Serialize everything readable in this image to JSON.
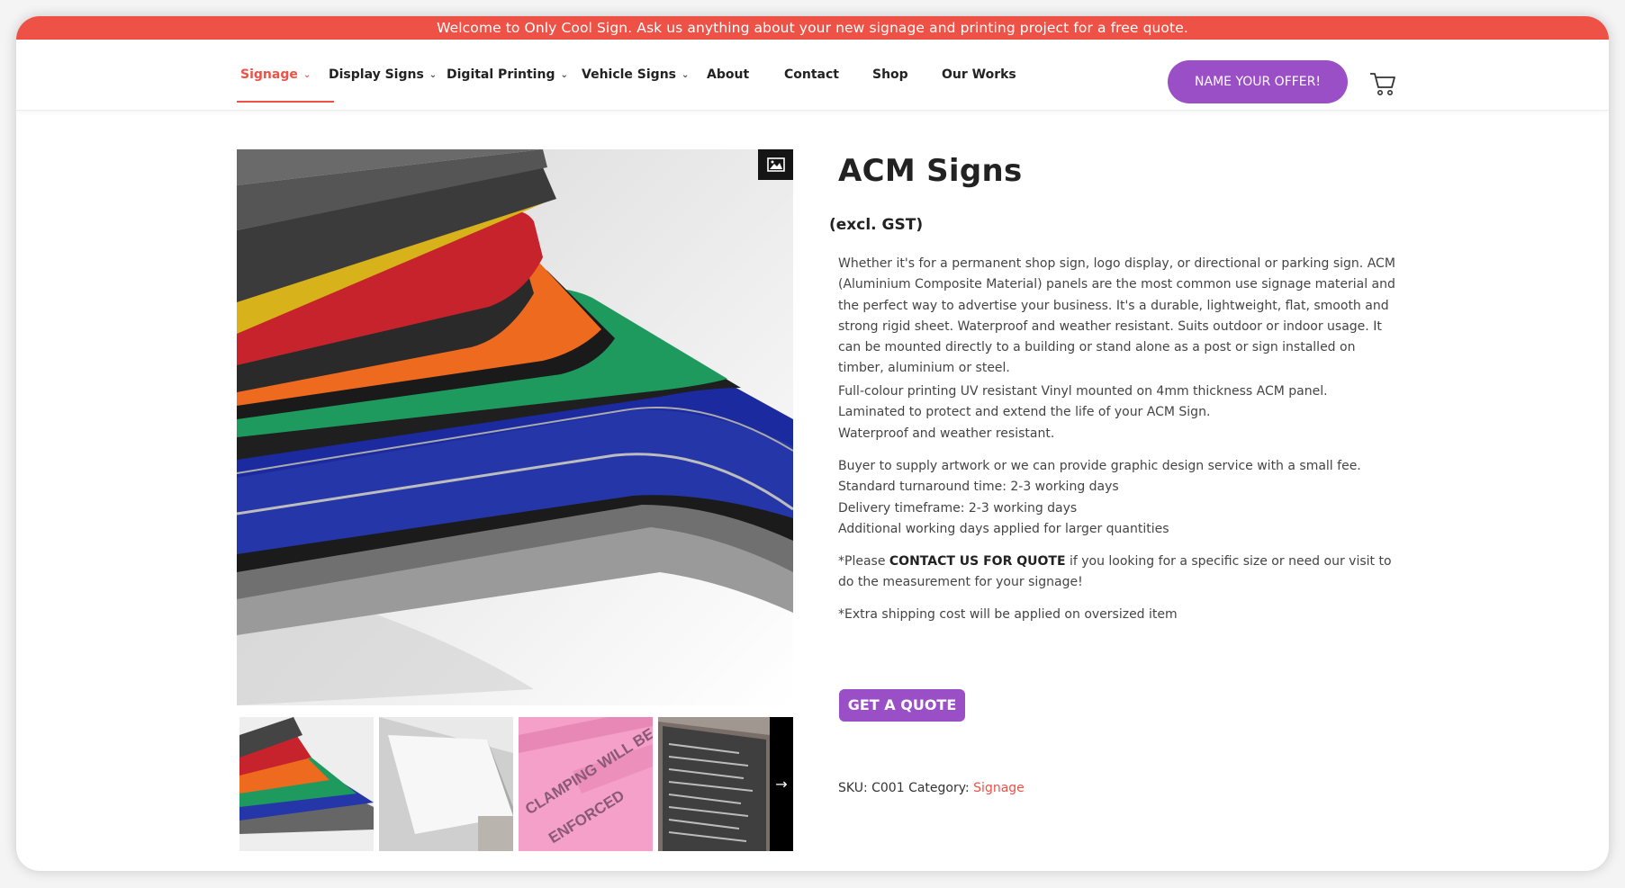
{
  "announcement": "Welcome to Only Cool Sign. Ask us anything about your new signage and printing project for a free quote.",
  "nav": {
    "items": [
      {
        "label": "Signage",
        "dropdown": true
      },
      {
        "label": "Display Signs",
        "dropdown": true
      },
      {
        "label": "Digital Printing",
        "dropdown": true
      },
      {
        "label": "Vehicle Signs",
        "dropdown": true
      },
      {
        "label": "About",
        "dropdown": false
      },
      {
        "label": "Contact",
        "dropdown": false
      },
      {
        "label": "Shop",
        "dropdown": false
      },
      {
        "label": "Our Works",
        "dropdown": false
      }
    ],
    "active": "Signage",
    "offer_button": "NAME YOUR OFFER!",
    "cart_icon": "cart-icon"
  },
  "product": {
    "title": "ACM Signs",
    "price_note": "(excl. GST)",
    "description": [
      "Whether it's for a permanent shop sign, logo display, or directional or parking sign. ACM (Aluminium Composite Material) panels are the most common use signage material and the perfect way to advertise your business. It's a durable, lightweight, flat, smooth and strong rigid sheet. Waterproof and weather resistant. Suits outdoor or indoor usage. It can be mounted directly to a building or stand alone as a post or sign installed on timber, aluminium or steel."
    ],
    "features": [
      "Full-colour printing UV resistant Vinyl mounted on 4mm thickness ACM panel.",
      "Laminated to protect and extend the life of your ACM Sign.",
      "Waterproof and weather resistant."
    ],
    "service": [
      "Buyer to supply artwork or we can provide graphic design service with a small fee.",
      "Standard turnaround time: 2-3 working days",
      "Delivery timeframe: 2-3 working days",
      "Additional working days applied for larger quantities"
    ],
    "contact_note": {
      "prefix": "*Please ",
      "bold": "CONTACT US FOR QUOTE",
      "suffix": " if you looking for a specific size or need our visit to do the measurement for your signage!"
    },
    "shipping_note": "*Extra shipping cost will be applied on oversized item",
    "quote_button": "GET A QUOTE",
    "sku_label": "SKU:",
    "sku": "C001",
    "category_label": "Category:",
    "category": "Signage"
  },
  "gallery": {
    "thumb_texts": [
      "CLAMPING WILL BE",
      "ENFORCED"
    ]
  },
  "colors": {
    "accent": "#ee5146",
    "purple": "#9a4fc6"
  }
}
